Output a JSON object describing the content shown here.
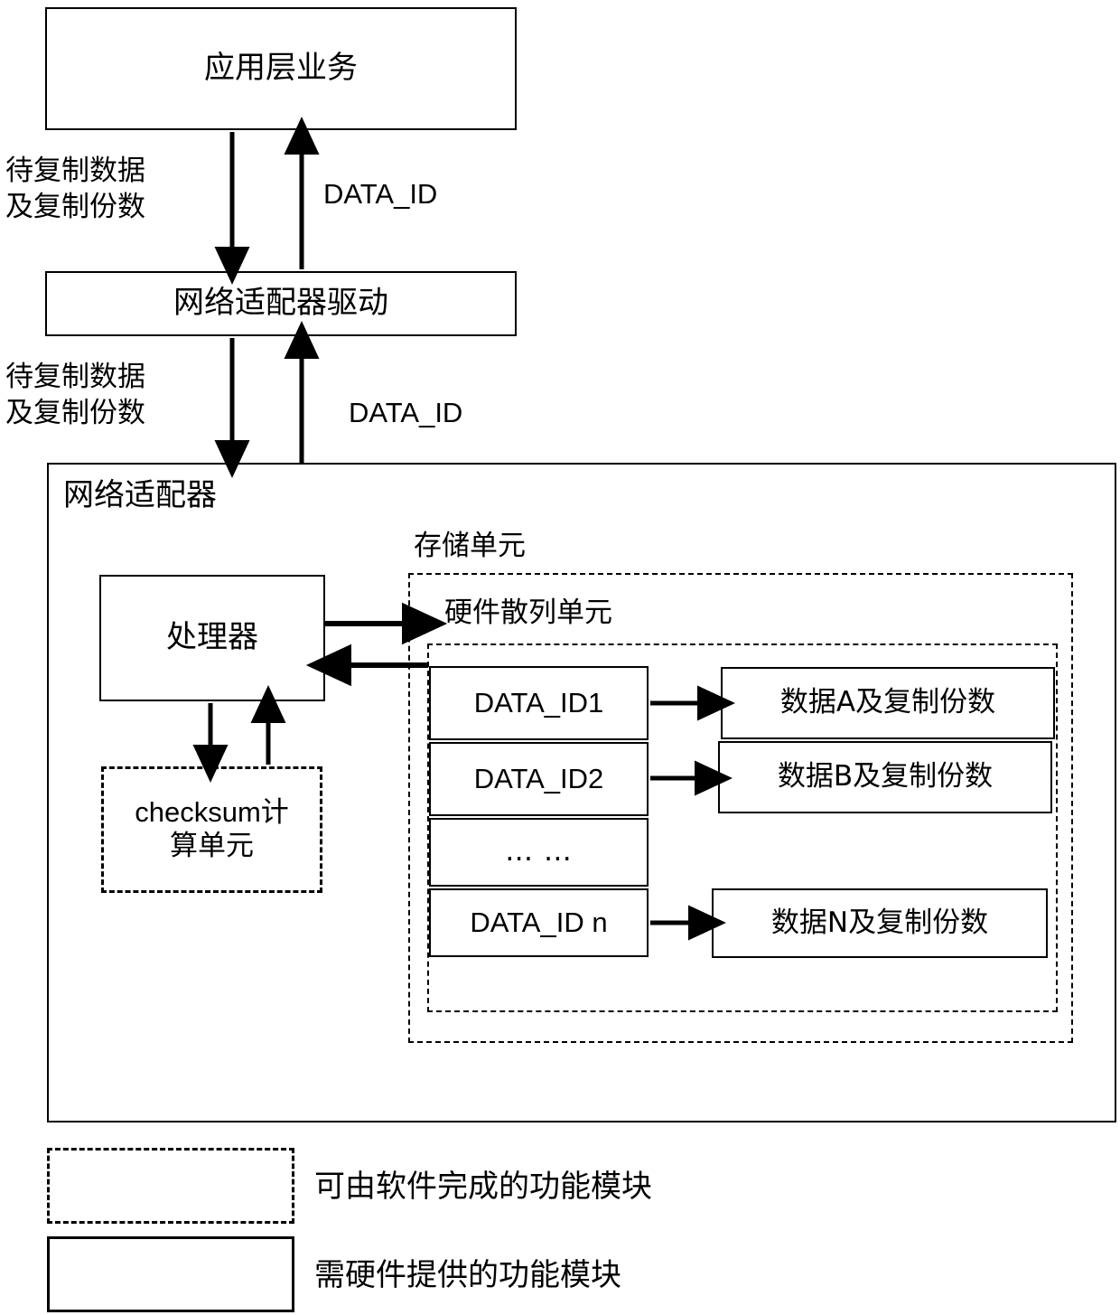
{
  "diagram": {
    "title_stack": {
      "app_layer": "应用层业务",
      "nic_driver": "网络适配器驱动",
      "nic": "网络适配器"
    },
    "flow_labels": {
      "down_label_1": "待复制数据\n及复制份数",
      "down_label_1_line1": "待复制数据",
      "down_label_1_line2": "及复制份数",
      "up_label_1": "DATA_ID",
      "down_label_2_line1": "待复制数据",
      "down_label_2_line2": "及复制份数",
      "up_label_2": "DATA_ID"
    },
    "nic_internals": {
      "processor": "处理器",
      "checksum_unit_line1": "checksum计",
      "checksum_unit_line2": "算单元",
      "storage_unit": "存储单元",
      "hardware_hash_unit": "硬件散列单元"
    },
    "hash_table": {
      "rows": [
        {
          "id": "DATA_ID1",
          "target": "数据A及复制份数"
        },
        {
          "id": "DATA_ID2",
          "target": "数据B及复制份数"
        },
        {
          "id": "… …",
          "target": ""
        },
        {
          "id": "DATA_ID n",
          "target": "数据N及复制份数"
        }
      ]
    },
    "legend": [
      {
        "style": "dash-dot",
        "text": "可由软件完成的功能模块"
      },
      {
        "style": "solid",
        "text": "需硬件提供的功能模块"
      }
    ],
    "colors": {
      "stroke": "#000000",
      "background": "#ffffff"
    }
  }
}
